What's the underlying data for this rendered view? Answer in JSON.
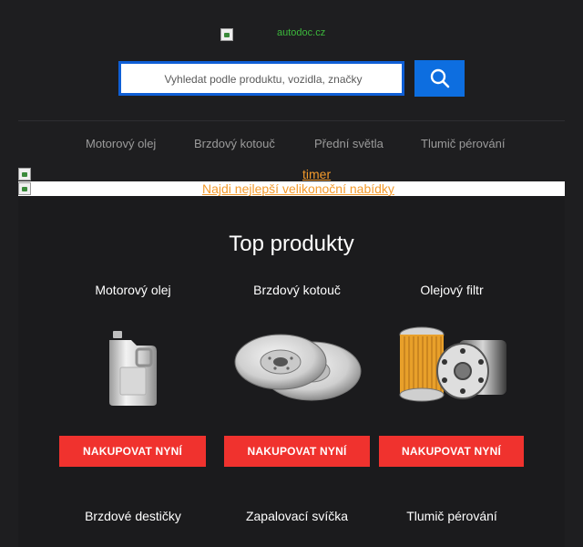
{
  "header": {
    "logo_text": "autodoc.cz",
    "search_placeholder": "Vyhledat podle produktu, vozidla, značky"
  },
  "nav": {
    "items": [
      {
        "label": "Motorový olej"
      },
      {
        "label": "Brzdový kotouč"
      },
      {
        "label": "Přední světla"
      },
      {
        "label": "Tlumič pérování"
      }
    ]
  },
  "banners": {
    "timer_text": "timer",
    "promo_text": "Najdi nejlepší velikonoční nabídky"
  },
  "top_products": {
    "title": "Top produkty",
    "products": [
      {
        "name": "Motorový olej",
        "button": "NAKUPOVAT NYNÍ",
        "image_icon": "oil-canister-icon"
      },
      {
        "name": "Brzdový kotouč",
        "button": "NAKUPOVAT NYNÍ",
        "image_icon": "brake-disc-icon"
      },
      {
        "name": "Olejový filtr",
        "button": "NAKUPOVAT NYNÍ",
        "image_icon": "oil-filter-icon"
      }
    ],
    "more_products": [
      {
        "name": "Brzdové destičky"
      },
      {
        "name": "Zapalovací svíčka"
      },
      {
        "name": "Tlumič pérování"
      }
    ]
  },
  "colors": {
    "background": "#1e1e20",
    "accent_blue": "#0d6ee0",
    "buy_red": "#f0322e",
    "link_orange": "#f39a2b",
    "logo_green": "#3cb83c"
  }
}
